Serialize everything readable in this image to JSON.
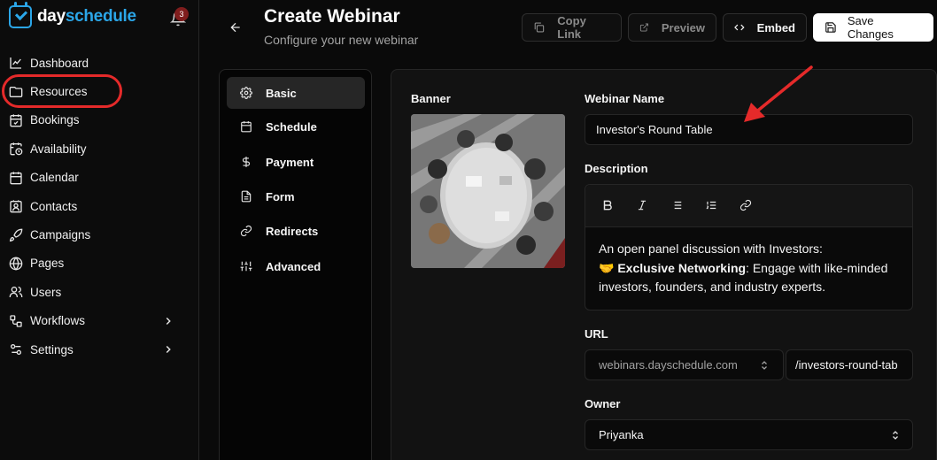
{
  "app": {
    "logo_day": "day",
    "logo_schedule": "schedule",
    "notification_count": "3",
    "accent_color": "#2ba6e8",
    "highlight_color": "#e52a2a"
  },
  "sidebar": {
    "items": [
      {
        "label": "Dashboard",
        "icon": "chart-line-icon"
      },
      {
        "label": "Resources",
        "icon": "folder-icon"
      },
      {
        "label": "Bookings",
        "icon": "calendar-check-icon"
      },
      {
        "label": "Availability",
        "icon": "calendar-clock-icon"
      },
      {
        "label": "Calendar",
        "icon": "calendar-icon"
      },
      {
        "label": "Contacts",
        "icon": "contact-icon"
      },
      {
        "label": "Campaigns",
        "icon": "rocket-icon"
      },
      {
        "label": "Pages",
        "icon": "globe-icon"
      },
      {
        "label": "Users",
        "icon": "users-icon"
      },
      {
        "label": "Workflows",
        "icon": "workflow-icon"
      },
      {
        "label": "Settings",
        "icon": "sliders-icon"
      }
    ]
  },
  "header": {
    "title": "Create Webinar",
    "subtitle": "Configure your new webinar",
    "copy_link": "Copy Link",
    "preview": "Preview",
    "embed": "Embed",
    "save": "Save Changes"
  },
  "menu": {
    "items": [
      {
        "label": "Basic",
        "icon": "gear-icon"
      },
      {
        "label": "Schedule",
        "icon": "calendar-icon"
      },
      {
        "label": "Payment",
        "icon": "dollar-icon"
      },
      {
        "label": "Form",
        "icon": "file-icon"
      },
      {
        "label": "Redirects",
        "icon": "link-icon"
      },
      {
        "label": "Advanced",
        "icon": "sliders-icon"
      }
    ]
  },
  "form": {
    "banner_label": "Banner",
    "name_label": "Webinar Name",
    "name_value": "Investor's Round Table",
    "description_label": "Description",
    "description_line1": "An open panel discussion with Investors:",
    "description_emoji": "🤝",
    "description_bold": "Exclusive Networking",
    "description_rest": ": Engage with like-minded investors, founders, and industry experts.",
    "url_label": "URL",
    "url_domain": "webinars.dayschedule.com",
    "url_slug": "/investors-round-tab",
    "owner_label": "Owner",
    "owner_value": "Priyanka"
  }
}
